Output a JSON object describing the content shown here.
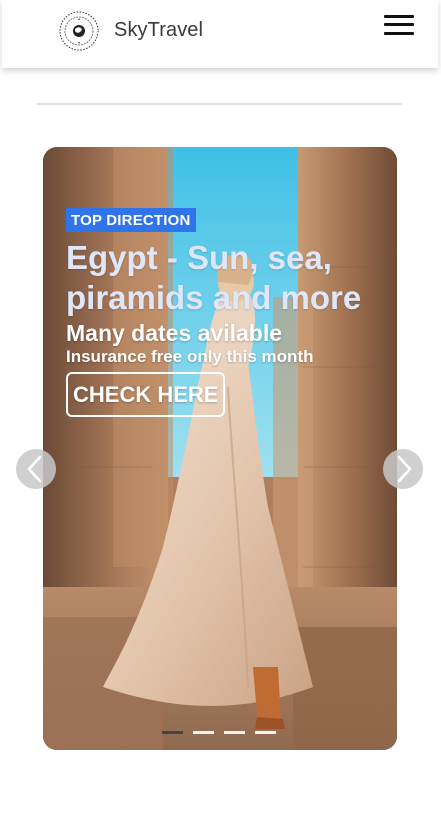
{
  "header": {
    "brand": "SkyTravel",
    "logo_icon": "globe-logo-icon",
    "menu_icon": "hamburger-menu-icon"
  },
  "carousel": {
    "slide": {
      "badge": "TOP DIRECTION",
      "headline": "Egypt - Sun, sea, piramids and more",
      "subhead": "Many dates avilable",
      "subline": "Insurance free only this month",
      "cta": "CHECK HERE"
    },
    "prev_icon": "chevron-left-icon",
    "next_icon": "chevron-right-icon",
    "indicator_count": 4,
    "active_index": 0
  },
  "colors": {
    "badge": "#2f74ea",
    "headline": "#dfe6f7"
  }
}
